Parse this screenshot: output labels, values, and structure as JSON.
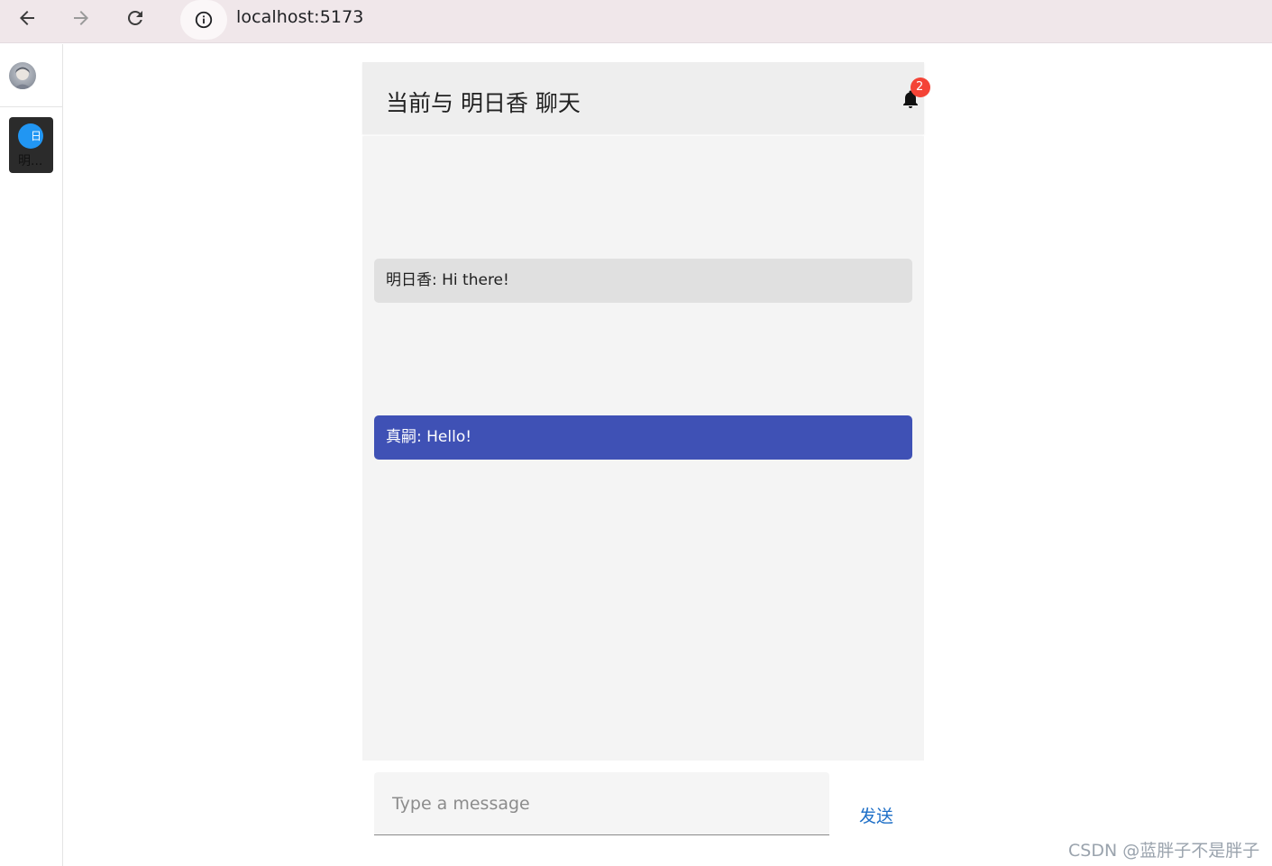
{
  "browser": {
    "url": "localhost:5173",
    "icons": [
      "back-arrow-icon",
      "forward-arrow-icon",
      "reload-icon",
      "site-info-icon"
    ]
  },
  "sidebar": {
    "contact": {
      "circle_text": "日",
      "name": "明..."
    }
  },
  "chat": {
    "title": "当前与 明日香 聊天",
    "notification_count": "2",
    "messages": [
      {
        "text": "明日香: Hi there!",
        "direction": "incoming"
      },
      {
        "text": "真嗣: Hello!",
        "direction": "outgoing"
      }
    ],
    "input_placeholder": "Type a message",
    "send_label": "发送"
  },
  "colors": {
    "outgoing_bubble": "#3f51b5",
    "incoming_bubble": "#e0e0e0",
    "badge": "#f44336",
    "send_text": "#1e6fc7"
  },
  "watermark": "CSDN @蓝胖子不是胖子"
}
